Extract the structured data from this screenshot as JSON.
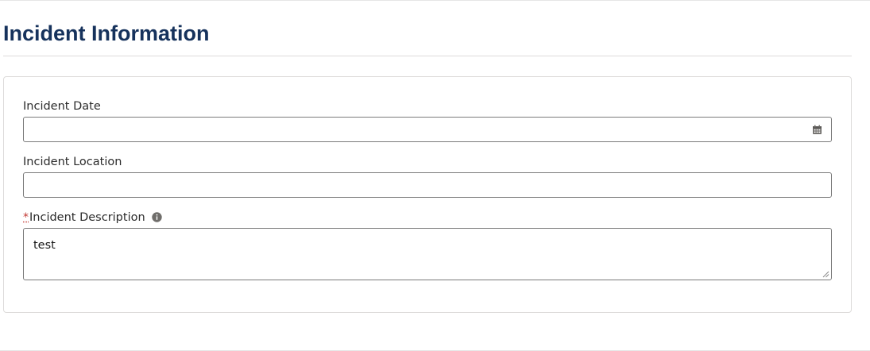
{
  "section": {
    "title": "Incident Information"
  },
  "form": {
    "incident_date": {
      "label": "Incident Date",
      "value": "",
      "icon": "calendar-icon"
    },
    "incident_location": {
      "label": "Incident Location",
      "value": ""
    },
    "incident_description": {
      "required_marker": "*",
      "label": "Incident Description",
      "value": "test",
      "help_icon": "info-icon"
    }
  },
  "colors": {
    "title": "#16325c",
    "required": "#c23934",
    "border": "#7a7a7a",
    "divider": "#dddbda"
  }
}
